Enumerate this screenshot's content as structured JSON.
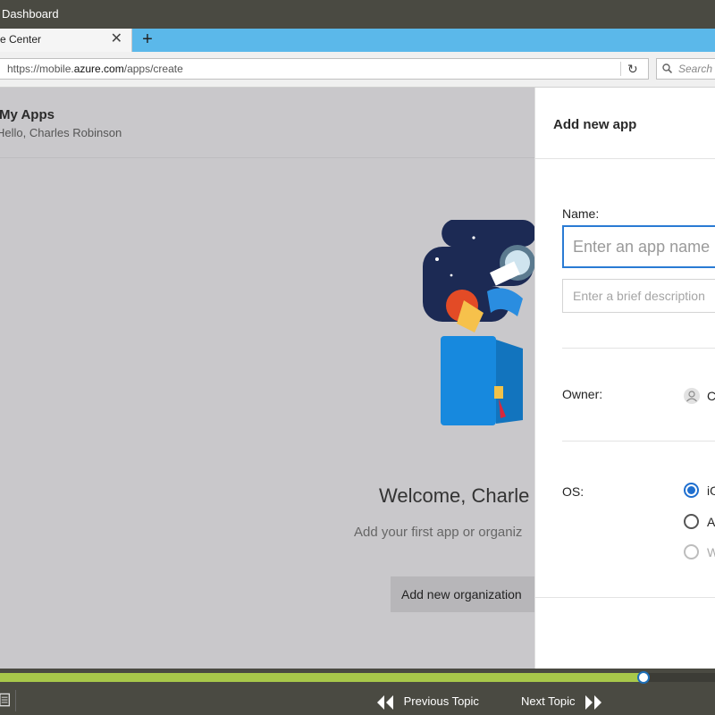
{
  "course_bar": {
    "title": "Dashboard"
  },
  "browser": {
    "tab_title": "e Center",
    "tab_close": "✕",
    "new_tab": "+",
    "url_prefix": "https://mobile.",
    "url_domain": "azure.com",
    "url_path": "/apps/create",
    "search_placeholder": "Search"
  },
  "page": {
    "title": "My Apps",
    "greeting": "Hello, Charles Robinson",
    "welcome": "Welcome, Charle",
    "subtext": "Add your first app or organiz",
    "add_org_button": "Add new organization"
  },
  "panel": {
    "title": "Add new app",
    "name_label": "Name:",
    "name_placeholder": "Enter an app name",
    "description_placeholder": "Enter a brief description",
    "owner_label": "Owner:",
    "owner_value": "C",
    "os_label": "OS:",
    "os_options": [
      {
        "label": "iOS",
        "state": "checked"
      },
      {
        "label": "A",
        "state": "unchecked"
      },
      {
        "label": "W",
        "state": "disabled"
      }
    ]
  },
  "player": {
    "progress_fraction": 0.9,
    "previous_label": "Previous Topic",
    "next_label": "Next Topic"
  },
  "colors": {
    "tab_strip": "#5bb8ea",
    "accent_blue": "#2a7bd4",
    "progress_green": "#a8c84a",
    "chrome_dark": "#4a4a42"
  }
}
